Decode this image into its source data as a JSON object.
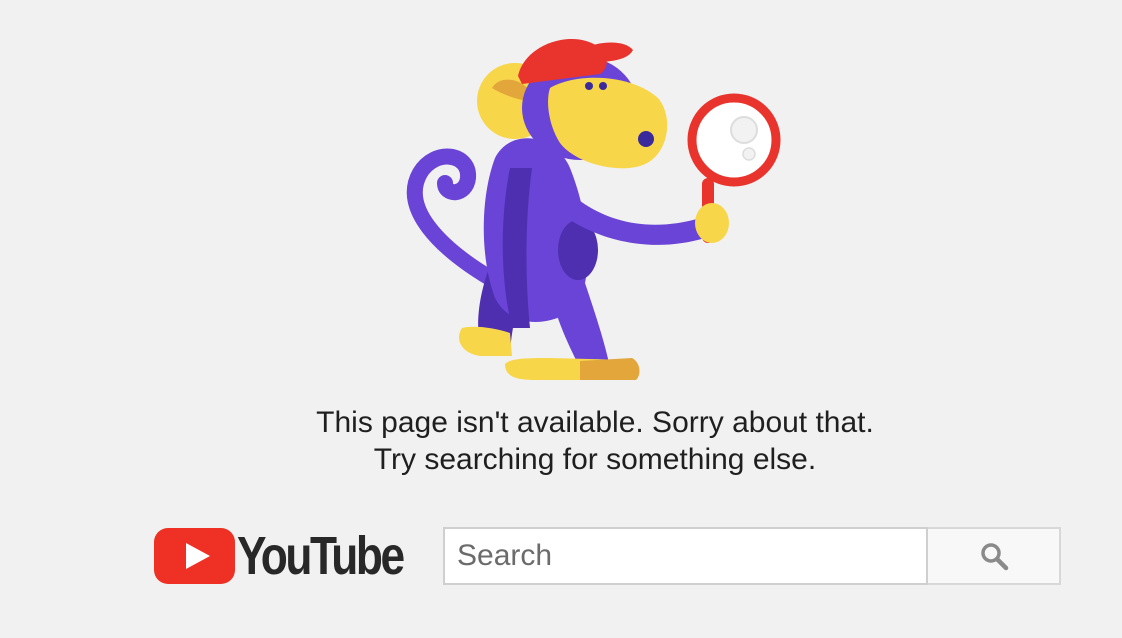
{
  "message": {
    "line1": "This page isn't available. Sorry about that.",
    "line2": "Try searching for something else."
  },
  "logo": {
    "text": "YouTube",
    "icon": "youtube-play-icon",
    "brand_color": "#ff0000"
  },
  "search": {
    "placeholder": "Search",
    "value": "",
    "button_icon": "search-icon"
  },
  "illustration": {
    "name": "monkey-with-magnifying-glass",
    "colors": {
      "fur": "#6a44d6",
      "fur_dark": "#4d2fb0",
      "face": "#f8d649",
      "cap": "#e8342c",
      "magnifier": "#e8342c"
    }
  },
  "colors": {
    "background": "#f1f1f1",
    "text": "#1f1f1f"
  }
}
